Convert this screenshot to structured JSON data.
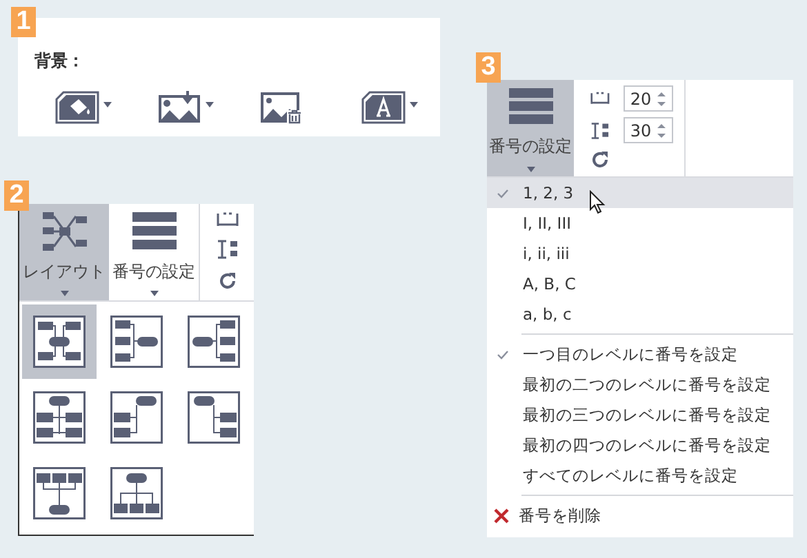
{
  "panel_1": {
    "badge": "1",
    "label": "背景：",
    "buttons": [
      {
        "kind": "fill",
        "dropdown": true
      },
      {
        "kind": "image-import",
        "dropdown": true
      },
      {
        "kind": "image-delete",
        "dropdown": false
      },
      {
        "kind": "text",
        "dropdown": true
      }
    ]
  },
  "panel_2": {
    "badge": "2",
    "tools": [
      {
        "kind": "layout",
        "label": "レイアウト",
        "selected": true
      },
      {
        "kind": "numbering",
        "label": "番号の設定",
        "selected": false
      }
    ],
    "layouts": [
      {
        "kind": "both-sides",
        "selected": true
      },
      {
        "kind": "right",
        "selected": false
      },
      {
        "kind": "left",
        "selected": false
      },
      {
        "kind": "down-both",
        "selected": false
      },
      {
        "kind": "down-left",
        "selected": false
      },
      {
        "kind": "down-right",
        "selected": false
      },
      {
        "kind": "up",
        "selected": false
      },
      {
        "kind": "org",
        "selected": false
      }
    ]
  },
  "panel_3": {
    "badge": "3",
    "numbering_button": {
      "label": "番号の設定",
      "selected": true
    },
    "spacing_fields": [
      {
        "kind": "horizontal",
        "value": "20"
      },
      {
        "kind": "vertical",
        "value": "30"
      }
    ],
    "formats": [
      {
        "label": "1, 2, 3",
        "checked": true,
        "selected": true
      },
      {
        "label": "I, II, III",
        "checked": false,
        "selected": false
      },
      {
        "label": "i, ii, iii",
        "checked": false,
        "selected": false
      },
      {
        "label": "A, B, C",
        "checked": false,
        "selected": false
      },
      {
        "label": "a, b, c",
        "checked": false,
        "selected": false
      }
    ],
    "levels": [
      {
        "label": "一つ目のレベルに番号を設定",
        "checked": true
      },
      {
        "label": "最初の二つのレベルに番号を設定",
        "checked": false
      },
      {
        "label": "最初の三つのレベルに番号を設定",
        "checked": false
      },
      {
        "label": "最初の四つのレベルに番号を設定",
        "checked": false
      },
      {
        "label": "すべてのレベルに番号を設定",
        "checked": false
      }
    ],
    "remove": {
      "label": "番号を削除"
    }
  }
}
